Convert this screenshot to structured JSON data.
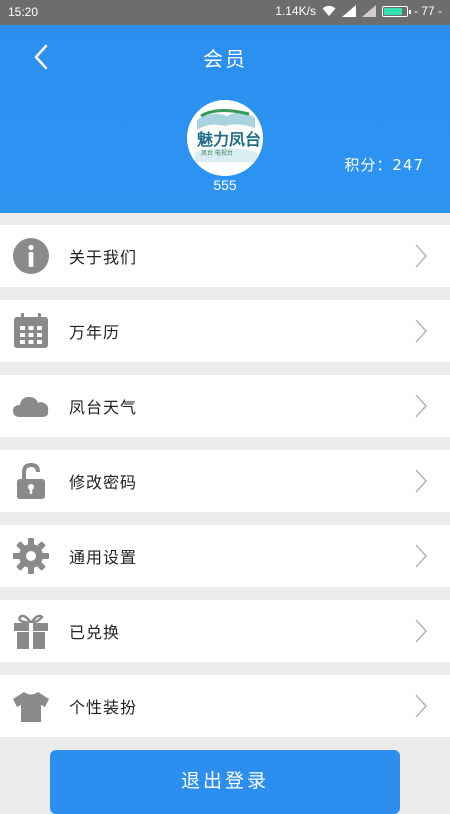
{
  "status_bar": {
    "time": "15:20",
    "net_speed": "1.14K/s",
    "battery_level": "77"
  },
  "header": {
    "title": "会员",
    "username": "555",
    "points": "积分：247"
  },
  "avatar": {
    "logo_text": "魅力凤台",
    "logo_subtext": "凤台 电视台"
  },
  "menu": {
    "items": [
      {
        "label": "关于我们",
        "icon": "info-icon"
      },
      {
        "label": "万年历",
        "icon": "calendar-icon"
      },
      {
        "label": "凤台天气",
        "icon": "cloud-icon"
      },
      {
        "label": "修改密码",
        "icon": "unlock-icon"
      },
      {
        "label": "通用设置",
        "icon": "gear-icon"
      },
      {
        "label": "已兑换",
        "icon": "gift-icon"
      },
      {
        "label": "个性装扮",
        "icon": "tshirt-icon"
      }
    ]
  },
  "logout_label": "退出登录",
  "colors": {
    "accent": "#2c8ff0",
    "icon_gray": "#8a8a8a",
    "background": "#ececec"
  }
}
